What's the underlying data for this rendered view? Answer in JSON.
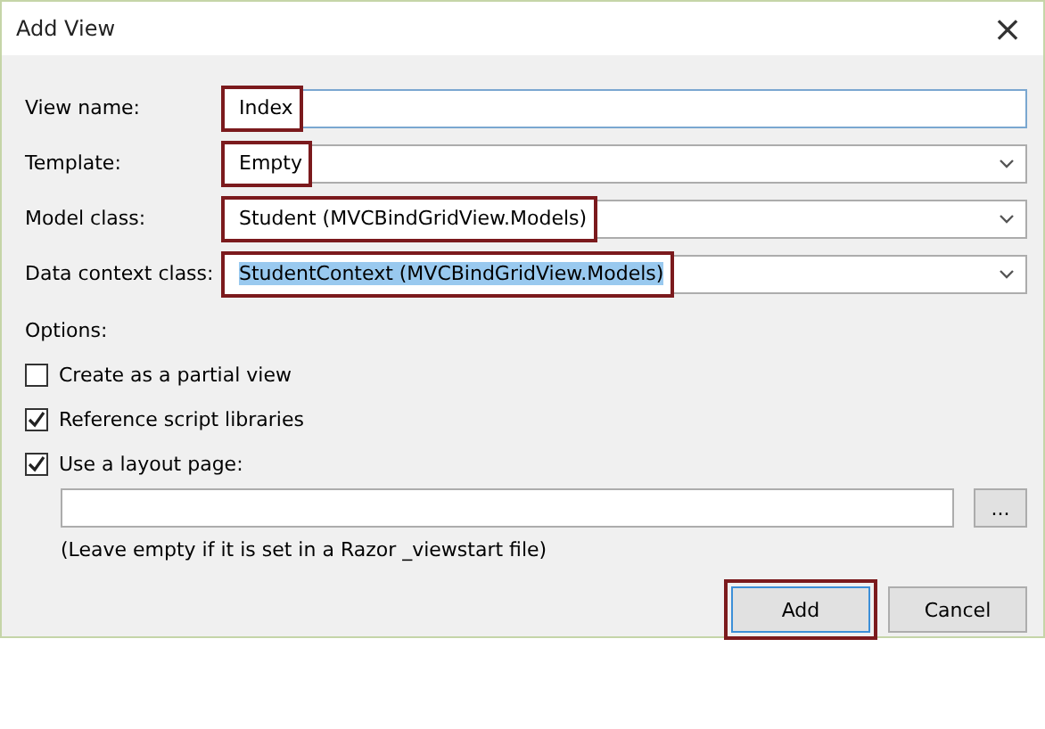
{
  "window": {
    "title": "Add View",
    "close": "×"
  },
  "fields": [
    {
      "label": "View name:",
      "kind": "text",
      "value": "Index",
      "highlighted": true,
      "text_selected": false
    },
    {
      "label": "Template:",
      "kind": "dropdown",
      "value": "Empty",
      "highlighted": true,
      "text_selected": false
    },
    {
      "label": "Model class:",
      "kind": "dropdown",
      "value": "Student (MVCBindGridView.Models)",
      "highlighted": true,
      "text_selected": false
    },
    {
      "label": "Data context class:",
      "kind": "dropdown",
      "value": "StudentContext (MVCBindGridView.Models)",
      "highlighted": true,
      "text_selected": true
    }
  ],
  "options": {
    "heading": "Options:",
    "items": [
      {
        "label": "Create as a partial view",
        "checked": false
      },
      {
        "label": "Reference script libraries",
        "checked": true
      },
      {
        "label": "Use a layout page:",
        "checked": true
      }
    ],
    "browse_button": "...",
    "hint": "(Leave empty if it is set in a Razor _viewstart file)"
  },
  "buttons": [
    {
      "label": "Add",
      "highlighted": true,
      "default": true
    },
    {
      "label": "Cancel",
      "highlighted": false,
      "default": false
    }
  ]
}
